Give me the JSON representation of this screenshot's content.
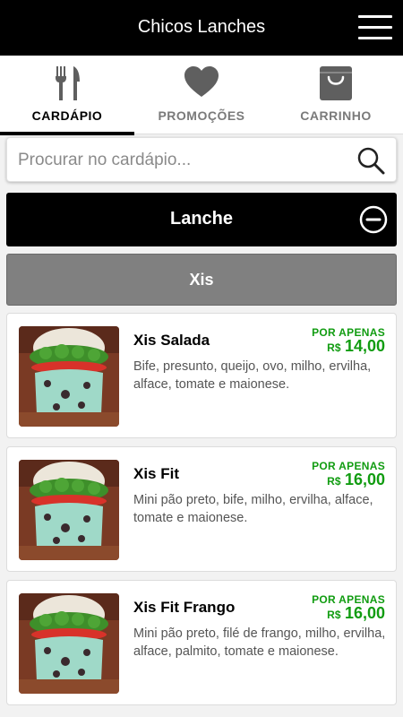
{
  "header": {
    "title": "Chicos Lanches",
    "menu_icon": "hamburger-menu-icon"
  },
  "tabs": [
    {
      "label": "CARDÁPIO",
      "icon": "fork-knife-icon",
      "active": true
    },
    {
      "label": "PROMOÇÕES",
      "icon": "heart-icon",
      "active": false
    },
    {
      "label": "CARRINHO",
      "icon": "shopping-bag-icon",
      "active": false
    }
  ],
  "search": {
    "placeholder": "Procurar no cardápio...",
    "value": ""
  },
  "category": {
    "label": "Lanche",
    "toggle_icon": "collapse-minus-icon"
  },
  "subcategory": {
    "label": "Xis"
  },
  "products": [
    {
      "name": "Xis Salada",
      "price_label": "POR APENAS",
      "currency": "R$",
      "price": "14,00",
      "description": "Bife, presunto, queijo, ovo, milho, ervilha, alface, tomate e maionese."
    },
    {
      "name": "Xis Fit",
      "price_label": "POR APENAS",
      "currency": "R$",
      "price": "16,00",
      "description": "Mini pão preto, bife, milho, ervilha, alface, tomate e maionese."
    },
    {
      "name": "Xis Fit Frango",
      "price_label": "POR APENAS",
      "currency": "R$",
      "price": "16,00",
      "description": "Mini pão preto, filé de frango, milho, ervilha, alface, palmito, tomate e maionese."
    }
  ],
  "colors": {
    "header_bg": "#000000",
    "price_green": "#119c11",
    "subcategory_bg": "#808080"
  }
}
